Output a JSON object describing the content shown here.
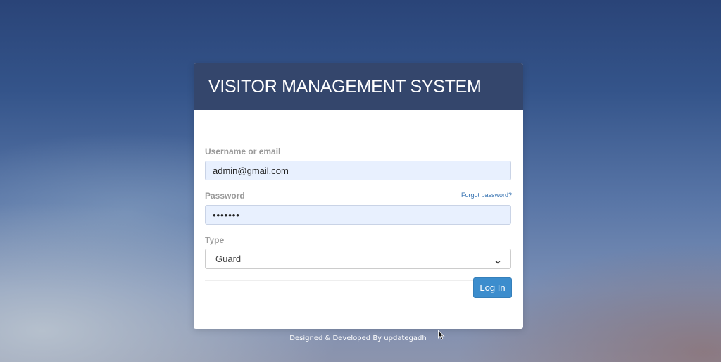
{
  "login_card": {
    "title": "VISITOR MANAGEMENT SYSTEM",
    "username": {
      "label": "Username or email",
      "value": "admin@gmail.com"
    },
    "password": {
      "label": "Password",
      "value": "•••••••",
      "forgot_link": "Forgot password?"
    },
    "type": {
      "label": "Type",
      "selected": "Guard"
    },
    "login_button": "Log In"
  },
  "footer": {
    "text": "Designed & Developed By updategadh"
  },
  "colors": {
    "header_bg": "#34466c",
    "button_bg": "#3c8dcd",
    "link": "#3370b0",
    "input_autofill_bg": "#e8f0fe"
  },
  "icons": {
    "select_arrow": "chevron-down-icon",
    "mouse_cursor": "mouse-pointer-icon"
  }
}
